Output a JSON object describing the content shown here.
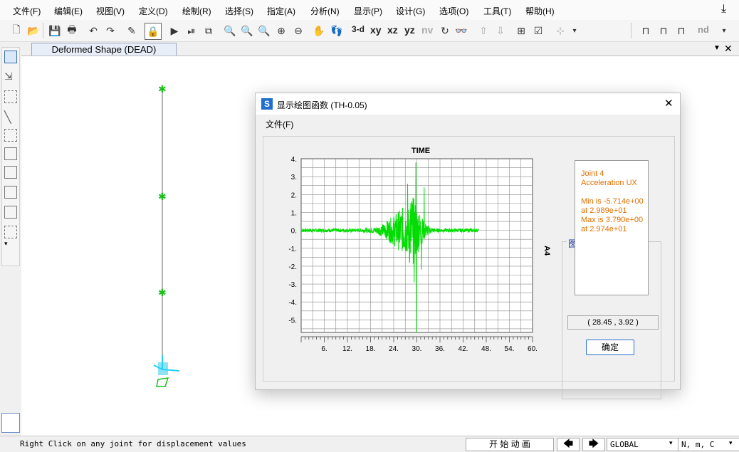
{
  "menu": [
    "文件(F)",
    "编辑(E)",
    "视图(V)",
    "定义(D)",
    "绘制(R)",
    "选择(S)",
    "指定(A)",
    "分析(N)",
    "显示(P)",
    "设计(G)",
    "选项(O)",
    "工具(T)",
    "帮助(H)"
  ],
  "toolbar": {
    "views": [
      "3-d",
      "xy",
      "xz",
      "yz",
      "nv"
    ],
    "nd_label": "nd"
  },
  "doc_tab": {
    "title": "Deformed Shape (DEAD)"
  },
  "dialog": {
    "title": "显示绘图函数  (TH-0.05)",
    "menu_file": "文件(F)",
    "chart_title": "TIME",
    "right_label": "A4",
    "legend_title": "图例",
    "legend_lines": [
      "Joint 4",
      "Acceleration  UX",
      "",
      "Min is -5.714e+00",
      "at 2.989e+01",
      "Max is 3.790e+00",
      "at 2.974e+01"
    ],
    "coord_readout": "( 28.45 , 3.92 )",
    "ok_label": "确定"
  },
  "chart_data": {
    "type": "line",
    "title": "TIME",
    "xticks": [
      "6.",
      "12.",
      "18.",
      "24.",
      "30.",
      "36.",
      "42.",
      "48.",
      "54.",
      "60."
    ],
    "yticks": [
      "4.",
      "3.",
      "2.",
      "1.",
      "0.",
      "-1.",
      "-2.",
      "-3.",
      "-4.",
      "-5."
    ],
    "xlim": [
      0,
      60
    ],
    "ylim": [
      -5.7,
      4.0
    ],
    "series": [
      {
        "name": "Joint 4 Acceleration UX",
        "color": "#00dd00",
        "min": -5.714,
        "min_at": 29.89,
        "max": 3.79,
        "max_at": 29.74
      }
    ]
  },
  "status": {
    "hint": "Right Click on any joint for displacement values",
    "animate": "开 始 动 画",
    "coord_sys": "GLOBAL",
    "units": "N, m, C"
  }
}
